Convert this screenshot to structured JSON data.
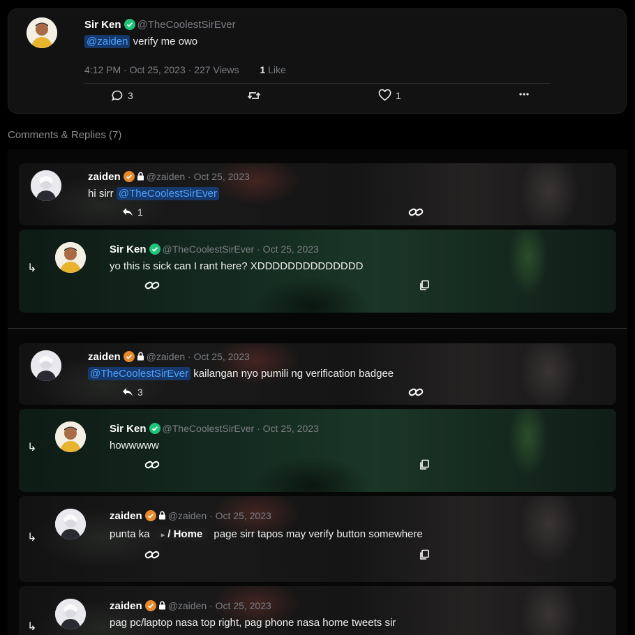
{
  "post": {
    "author_name": "Sir Ken",
    "author_handle": "@TheCoolestSirEver",
    "mention": "@zaiden",
    "text": " verify me owo",
    "timestamp": "4:12 PM · Oct 25, 2023 · 227 Views",
    "likes_count": "1",
    "likes_label": " Like",
    "actions": {
      "comments": "3",
      "likes": "1"
    }
  },
  "section_title": "Comments & Replies (7)",
  "threads": [
    {
      "comment": {
        "name": "zaiden",
        "handle": "@zaiden · Oct 25, 2023",
        "mention": "@TheCoolestSirEver",
        "text_before": "hi sirr ",
        "text_after": "",
        "reply_count": "1"
      },
      "replies": [
        {
          "name": "Sir Ken",
          "handle": "@TheCoolestSirEver · Oct 25, 2023",
          "text": "yo this is sick can I rant here? XDDDDDDDDDDDDDD"
        }
      ]
    },
    {
      "comment": {
        "name": "zaiden",
        "handle": "@zaiden · Oct 25, 2023",
        "mention": "@TheCoolestSirEver",
        "text_after": " kailangan nyo pumili ng verification badgee",
        "reply_count": "3"
      },
      "replies": [
        {
          "name": "Sir Ken",
          "handle": "@TheCoolestSirEver · Oct 25, 2023",
          "text": "howwwww"
        },
        {
          "name": "zaiden",
          "handle": "@zaiden · Oct 25, 2023",
          "text_before": "punta ka ",
          "chip": "/ Home",
          "text_after": " page sirr tapos may verify button somewhere"
        },
        {
          "name": "zaiden",
          "handle": "@zaiden · Oct 25, 2023",
          "text": "pag pc/laptop nasa top right, pag phone nasa home tweets sir"
        }
      ]
    }
  ],
  "icons": {
    "verified_green": "#1fc47a",
    "verified_orange": "#e8892b",
    "mention_bg": "#16386b",
    "mention_fg": "#4da3ff"
  }
}
